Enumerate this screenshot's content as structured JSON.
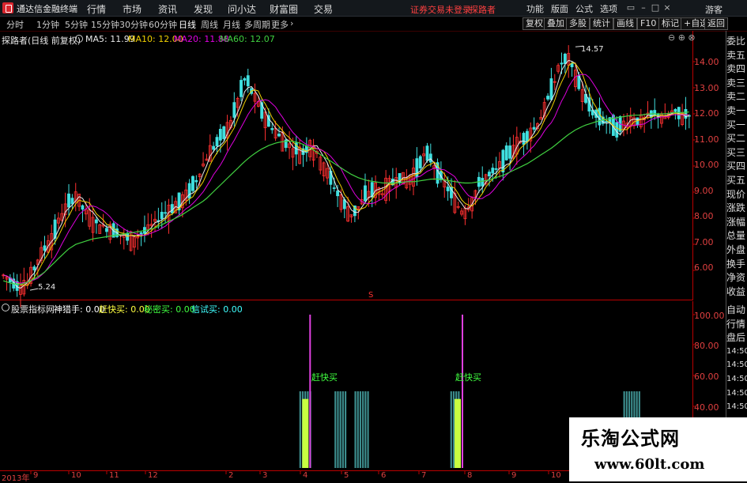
{
  "menubar": {
    "app_title": "通达信金融终端",
    "items": [
      "行情",
      "市场",
      "资讯",
      "发现",
      "问小达",
      "财富圈",
      "交易"
    ],
    "login_warning": "证券交易未登录",
    "login_user": "探路者",
    "right_items": [
      "功能",
      "版面",
      "公式",
      "选项"
    ],
    "guest": "游客"
  },
  "toolbar": {
    "periods": [
      "分时",
      "1分钟",
      "5分钟",
      "15分钟",
      "30分钟",
      "60分钟",
      "日线",
      "周线",
      "月线",
      "多周期",
      "更多"
    ],
    "active_period": "日线",
    "buttons": [
      "复权",
      "叠加",
      "多股",
      "统计",
      "画线",
      "F10",
      "标记",
      "+自选",
      "返回"
    ]
  },
  "main_chart": {
    "title": "探路者(日线 前复权)",
    "ma": [
      {
        "label": "MA5: 11.99",
        "color": "#e8e8e8"
      },
      {
        "label": "MA10: 12.00",
        "color": "#f0d000"
      },
      {
        "label": "MA20: 11.88",
        "color": "#e000e0"
      },
      {
        "label": "MA60: 12.07",
        "color": "#40d040"
      }
    ],
    "high_label": "14.57",
    "low_label": "5.24",
    "s_marker": "S",
    "y_ticks": [
      "14.00",
      "13.00",
      "12.00",
      "11.00",
      "10.00",
      "9.00",
      "8.00",
      "7.00",
      "6.00"
    ]
  },
  "indicator": {
    "title": "股票指标网",
    "items": [
      {
        "label": "神猎手: 0.00",
        "color": "#ffffff"
      },
      {
        "label": "赶快买: 0.00",
        "color": "#ffff40"
      },
      {
        "label": "秘密买: 0.00",
        "color": "#40ff40"
      },
      {
        "label": "信试买: 0.00",
        "color": "#40ffff"
      }
    ],
    "buy_label_1": "赶快买",
    "buy_label_2": "赶快买",
    "y_ticks": [
      "100.00",
      "80.00",
      "60.00",
      "40.00"
    ]
  },
  "side_panel": {
    "quote_labels": [
      "委比",
      "卖五",
      "卖四",
      "卖三",
      "卖二",
      "卖一",
      "买一",
      "买二",
      "买三",
      "买四",
      "买五",
      "现价",
      "涨跌",
      "涨幅",
      "总量",
      "外盘",
      "换手",
      "净资",
      "收益"
    ],
    "bottom_labels": [
      "自动",
      "行情",
      "盘后",
      "14:50",
      "14:50",
      "14:50",
      "14:50",
      "14:50",
      "14:50",
      "14:50"
    ]
  },
  "date_axis": {
    "labels": [
      "2013年",
      "9",
      "10",
      "11",
      "12",
      "2",
      "3",
      "4",
      "5",
      "6",
      "7",
      "8",
      "9",
      "10"
    ]
  },
  "watermark": {
    "cn": "乐淘公式网",
    "url": "www.60lt.com"
  },
  "chart_data": {
    "type": "candlestick",
    "price_range": [
      5.0,
      15.0
    ],
    "close_path": [
      5.8,
      5.6,
      5.35,
      5.5,
      6.2,
      6.8,
      7.2,
      8.0,
      8.5,
      8.9,
      8.3,
      7.9,
      7.7,
      7.6,
      7.5,
      7.3,
      7.1,
      7.4,
      7.6,
      7.9,
      8.2,
      8.4,
      8.6,
      9.0,
      9.5,
      10.2,
      10.7,
      11.1,
      11.5,
      12.4,
      13.4,
      12.7,
      12.1,
      11.6,
      11.2,
      10.9,
      10.6,
      10.5,
      10.8,
      10.4,
      9.8,
      9.2,
      8.6,
      8.1,
      8.4,
      8.9,
      9.1,
      9.0,
      9.3,
      9.6,
      9.4,
      9.7,
      10.4,
      10.3,
      9.6,
      9.2,
      8.6,
      8.2,
      8.6,
      9.3,
      9.6,
      9.8,
      10.2,
      10.6,
      10.9,
      11.2,
      11.5,
      12.1,
      13.0,
      13.9,
      14.1,
      13.4,
      12.6,
      12.1,
      11.8,
      11.7,
      11.4,
      11.6,
      11.8,
      11.7,
      11.9,
      12.0,
      11.8,
      12.1,
      11.9,
      12.0
    ],
    "ma60_path": [
      5.6,
      5.5,
      5.45,
      5.55,
      5.7,
      5.9,
      6.2,
      6.5,
      6.8,
      7.0,
      7.1,
      7.2,
      7.25,
      7.3,
      7.35,
      7.4,
      7.45,
      7.5,
      7.55,
      7.65,
      7.8,
      7.95,
      8.1,
      8.3,
      8.5,
      8.7,
      9.0,
      9.3,
      9.6,
      9.9,
      10.2,
      10.45,
      10.65,
      10.8,
      10.9,
      10.95,
      10.95,
      10.85,
      10.7,
      10.5,
      10.3,
      10.1,
      9.9,
      9.7,
      9.55,
      9.45,
      9.4,
      9.35,
      9.35,
      9.35,
      9.4,
      9.4,
      9.45,
      9.5,
      9.5,
      9.45,
      9.4,
      9.35,
      9.35,
      9.4,
      9.45,
      9.55,
      9.65,
      9.8,
      9.95,
      10.1,
      10.3,
      10.5,
      10.7,
      10.95,
      11.2,
      11.4,
      11.55,
      11.65,
      11.75,
      11.8,
      11.85,
      11.9,
      11.95,
      11.95,
      12.0,
      12.0,
      12.0,
      12.05,
      12.05,
      12.07
    ],
    "buy_signals": [
      0.443,
      0.664
    ],
    "indicator_bars_x": [
      0.436,
      0.45,
      0.484,
      0.495,
      0.517,
      0.527,
      0.657,
      0.905,
      0.918
    ]
  }
}
